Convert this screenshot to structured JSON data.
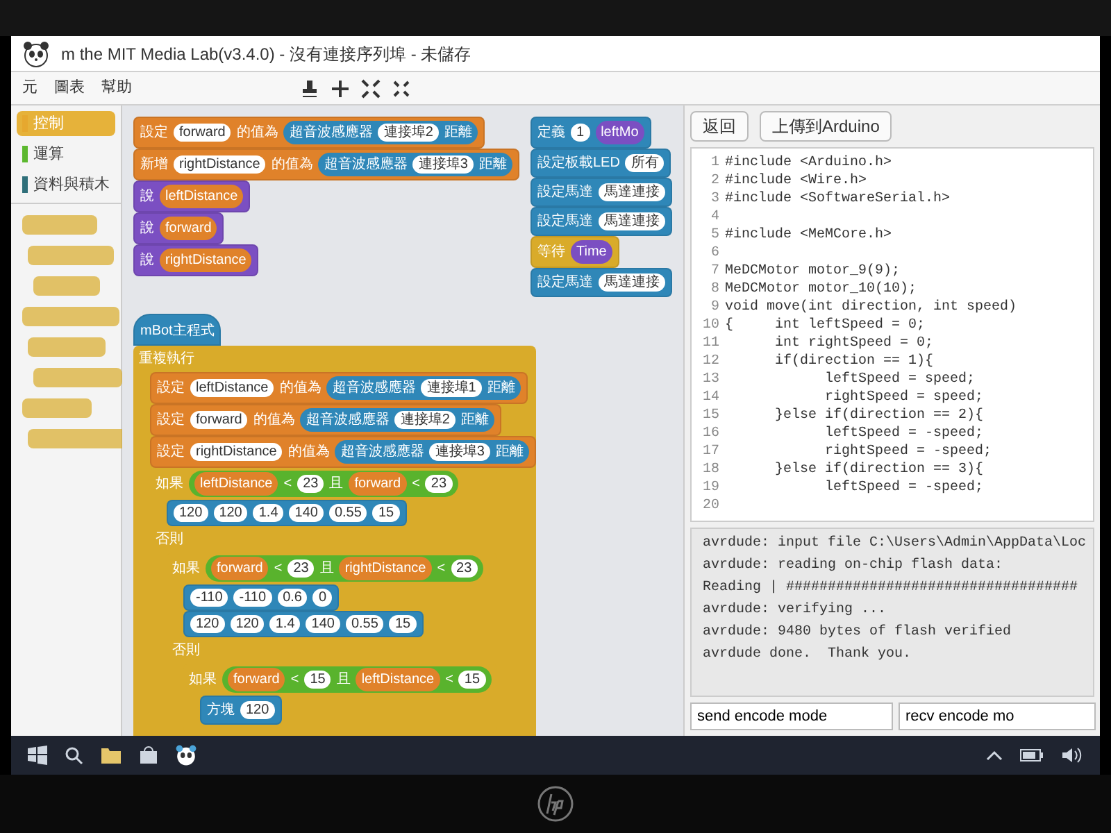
{
  "window": {
    "title": "m the MIT Media Lab(v3.4.0) - 沒有連接序列埠 - 未儲存"
  },
  "menu": [
    "元",
    "圖表",
    "幫助"
  ],
  "categories": [
    {
      "label": "控制",
      "selected": true,
      "color": "#e6a82f"
    },
    {
      "label": "運算",
      "selected": false,
      "color": "#5cb82f"
    },
    {
      "label": "資料與積木",
      "selected": false,
      "color": "#2f6f7a"
    }
  ],
  "scripts": [
    [
      {
        "kind": "stack",
        "color": "#e0822a",
        "parts": [
          {
            "kind": "text",
            "text": "設定"
          },
          {
            "kind": "field",
            "text": "forward"
          },
          {
            "kind": "text",
            "text": "的值為"
          },
          {
            "kind": "reporter",
            "color": "#2f87b8",
            "parts": [
              {
                "kind": "text",
                "text": "超音波感應器"
              },
              {
                "kind": "field",
                "text": "連接埠2"
              },
              {
                "kind": "text",
                "text": "距離"
              }
            ]
          }
        ]
      },
      {
        "kind": "stack",
        "color": "#e0822a",
        "parts": [
          {
            "kind": "text",
            "text": "新增"
          },
          {
            "kind": "field",
            "text": "rightDistance"
          },
          {
            "kind": "text",
            "text": "的值為"
          },
          {
            "kind": "reporter",
            "color": "#2f87b8",
            "parts": [
              {
                "kind": "text",
                "text": "超音波感應器"
              },
              {
                "kind": "field",
                "text": "連接埠3"
              },
              {
                "kind": "text",
                "text": "距離"
              }
            ]
          }
        ]
      },
      {
        "kind": "stack",
        "color": "#7b4fc2",
        "parts": [
          {
            "kind": "text",
            "text": "說"
          },
          {
            "kind": "reporter",
            "color": "#e0822a",
            "parts": [
              {
                "kind": "text",
                "text": "leftDistance"
              }
            ]
          }
        ]
      },
      {
        "kind": "stack",
        "color": "#7b4fc2",
        "parts": [
          {
            "kind": "text",
            "text": "說"
          },
          {
            "kind": "reporter",
            "color": "#e0822a",
            "parts": [
              {
                "kind": "text",
                "text": "forward"
              }
            ]
          }
        ]
      },
      {
        "kind": "stack",
        "color": "#7b4fc2",
        "parts": [
          {
            "kind": "text",
            "text": "說"
          },
          {
            "kind": "reporter",
            "color": "#e0822a",
            "parts": [
              {
                "kind": "text",
                "text": "rightDistance"
              }
            ]
          }
        ]
      }
    ],
    [
      {
        "kind": "stack",
        "color": "#2f87b8",
        "parts": [
          {
            "kind": "text",
            "text": "定義"
          },
          {
            "kind": "field",
            "text": "1"
          },
          {
            "kind": "reporter",
            "color": "#7b4fc2",
            "parts": [
              {
                "kind": "text",
                "text": "leftMo"
              }
            ]
          }
        ]
      },
      {
        "kind": "stack",
        "color": "#2f87b8",
        "parts": [
          {
            "kind": "text",
            "text": "設定板載LED"
          },
          {
            "kind": "field",
            "text": "所有"
          }
        ]
      },
      {
        "kind": "stack",
        "color": "#2f87b8",
        "parts": [
          {
            "kind": "text",
            "text": "設定馬達"
          },
          {
            "kind": "field",
            "text": "馬達連接"
          }
        ]
      },
      {
        "kind": "stack",
        "color": "#2f87b8",
        "parts": [
          {
            "kind": "text",
            "text": "設定馬達"
          },
          {
            "kind": "field",
            "text": "馬達連接"
          }
        ]
      },
      {
        "kind": "stack",
        "color": "#d9ab2a",
        "parts": [
          {
            "kind": "text",
            "text": "等待"
          },
          {
            "kind": "reporter",
            "color": "#7b4fc2",
            "parts": [
              {
                "kind": "text",
                "text": "Time"
              }
            ]
          }
        ]
      },
      {
        "kind": "stack",
        "color": "#2f87b8",
        "parts": [
          {
            "kind": "text",
            "text": "設定馬達"
          },
          {
            "kind": "field",
            "text": "馬達連接"
          }
        ]
      }
    ],
    [
      {
        "kind": "hat",
        "color": "#2f87b8",
        "parts": [
          {
            "kind": "text",
            "text": "mBot主程式"
          }
        ]
      },
      {
        "kind": "c",
        "color": "#d9ab2a",
        "parts": [
          {
            "kind": "text",
            "text": "重複執行"
          }
        ],
        "children": [
          {
            "kind": "stack",
            "color": "#e0822a",
            "parts": [
              {
                "kind": "text",
                "text": "設定"
              },
              {
                "kind": "field",
                "text": "leftDistance"
              },
              {
                "kind": "text",
                "text": "的值為"
              },
              {
                "kind": "reporter",
                "color": "#2f87b8",
                "parts": [
                  {
                    "kind": "text",
                    "text": "超音波感應器"
                  },
                  {
                    "kind": "field",
                    "text": "連接埠1"
                  },
                  {
                    "kind": "text",
                    "text": "距離"
                  }
                ]
              }
            ]
          },
          {
            "kind": "stack",
            "color": "#e0822a",
            "parts": [
              {
                "kind": "text",
                "text": "設定"
              },
              {
                "kind": "field",
                "text": "forward"
              },
              {
                "kind": "text",
                "text": "的值為"
              },
              {
                "kind": "reporter",
                "color": "#2f87b8",
                "parts": [
                  {
                    "kind": "text",
                    "text": "超音波感應器"
                  },
                  {
                    "kind": "field",
                    "text": "連接埠2"
                  },
                  {
                    "kind": "text",
                    "text": "距離"
                  }
                ]
              }
            ]
          },
          {
            "kind": "stack",
            "color": "#e0822a",
            "parts": [
              {
                "kind": "text",
                "text": "設定"
              },
              {
                "kind": "field",
                "text": "rightDistance"
              },
              {
                "kind": "text",
                "text": "的值為"
              },
              {
                "kind": "reporter",
                "color": "#2f87b8",
                "parts": [
                  {
                    "kind": "text",
                    "text": "超音波感應器"
                  },
                  {
                    "kind": "field",
                    "text": "連接埠3"
                  },
                  {
                    "kind": "text",
                    "text": "距離"
                  }
                ]
              }
            ]
          },
          {
            "kind": "c",
            "color": "#d9ab2a",
            "parts": [
              {
                "kind": "text",
                "text": "如果"
              },
              {
                "kind": "reporter",
                "color": "#59b32d",
                "parts": [
                  {
                    "kind": "reporter",
                    "color": "#e0822a",
                    "parts": [
                      {
                        "kind": "text",
                        "text": "leftDistance"
                      }
                    ]
                  },
                  {
                    "kind": "text",
                    "text": "<"
                  },
                  {
                    "kind": "field",
                    "text": "23"
                  },
                  {
                    "kind": "text",
                    "text": "且"
                  },
                  {
                    "kind": "reporter",
                    "color": "#e0822a",
                    "parts": [
                      {
                        "kind": "text",
                        "text": "forward"
                      }
                    ]
                  },
                  {
                    "kind": "text",
                    "text": "<"
                  },
                  {
                    "kind": "field",
                    "text": "23"
                  }
                ]
              }
            ],
            "children": [
              {
                "kind": "stack",
                "color": "#2f87b8",
                "parts": [
                  {
                    "kind": "field",
                    "text": "120"
                  },
                  {
                    "kind": "field",
                    "text": "120"
                  },
                  {
                    "kind": "field",
                    "text": "1.4"
                  },
                  {
                    "kind": "field",
                    "text": "140"
                  },
                  {
                    "kind": "field",
                    "text": "0.55"
                  },
                  {
                    "kind": "field",
                    "text": "15"
                  }
                ]
              }
            ],
            "else_label": "否則",
            "else_children": [
              {
                "kind": "c",
                "color": "#d9ab2a",
                "parts": [
                  {
                    "kind": "text",
                    "text": "如果"
                  },
                  {
                    "kind": "reporter",
                    "color": "#59b32d",
                    "parts": [
                      {
                        "kind": "reporter",
                        "color": "#e0822a",
                        "parts": [
                          {
                            "kind": "text",
                            "text": "forward"
                          }
                        ]
                      },
                      {
                        "kind": "text",
                        "text": "<"
                      },
                      {
                        "kind": "field",
                        "text": "23"
                      },
                      {
                        "kind": "text",
                        "text": "且"
                      },
                      {
                        "kind": "reporter",
                        "color": "#e0822a",
                        "parts": [
                          {
                            "kind": "text",
                            "text": "rightDistance"
                          }
                        ]
                      },
                      {
                        "kind": "text",
                        "text": "<"
                      },
                      {
                        "kind": "field",
                        "text": "23"
                      }
                    ]
                  }
                ],
                "children": [
                  {
                    "kind": "stack",
                    "color": "#2f87b8",
                    "parts": [
                      {
                        "kind": "field",
                        "text": "-110"
                      },
                      {
                        "kind": "field",
                        "text": "-110"
                      },
                      {
                        "kind": "field",
                        "text": "0.6"
                      },
                      {
                        "kind": "field",
                        "text": "0"
                      }
                    ]
                  },
                  {
                    "kind": "stack",
                    "color": "#2f87b8",
                    "parts": [
                      {
                        "kind": "field",
                        "text": "120"
                      },
                      {
                        "kind": "field",
                        "text": "120"
                      },
                      {
                        "kind": "field",
                        "text": "1.4"
                      },
                      {
                        "kind": "field",
                        "text": "140"
                      },
                      {
                        "kind": "field",
                        "text": "0.55"
                      },
                      {
                        "kind": "field",
                        "text": "15"
                      }
                    ]
                  }
                ],
                "else_label": "否則",
                "else_children": [
                  {
                    "kind": "c",
                    "color": "#d9ab2a",
                    "parts": [
                      {
                        "kind": "text",
                        "text": "如果"
                      },
                      {
                        "kind": "reporter",
                        "color": "#59b32d",
                        "parts": [
                          {
                            "kind": "reporter",
                            "color": "#e0822a",
                            "parts": [
                              {
                                "kind": "text",
                                "text": "forward"
                              }
                            ]
                          },
                          {
                            "kind": "text",
                            "text": "<"
                          },
                          {
                            "kind": "field",
                            "text": "15"
                          },
                          {
                            "kind": "text",
                            "text": "且"
                          },
                          {
                            "kind": "reporter",
                            "color": "#e0822a",
                            "parts": [
                              {
                                "kind": "text",
                                "text": "leftDistance"
                              }
                            ]
                          },
                          {
                            "kind": "text",
                            "text": "<"
                          },
                          {
                            "kind": "field",
                            "text": "15"
                          }
                        ]
                      }
                    ],
                    "children": [
                      {
                        "kind": "stack",
                        "color": "#2f87b8",
                        "parts": [
                          {
                            "kind": "text",
                            "text": "方塊"
                          },
                          {
                            "kind": "field",
                            "text": "120"
                          }
                        ]
                      }
                    ]
                  }
                ]
              }
            ]
          }
        ]
      }
    ]
  ],
  "buttons": [
    "返回",
    "上傳到Arduino"
  ],
  "code": [
    {
      "num": "1",
      "text": "#include <Arduino.h>"
    },
    {
      "num": "2",
      "text": "#include <Wire.h>"
    },
    {
      "num": "3",
      "text": "#include <SoftwareSerial.h>"
    },
    {
      "num": "4"
    },
    {
      "num": "5",
      "text": "#include <MeMCore.h>"
    },
    {
      "num": "6"
    },
    {
      "num": "7",
      "text": "MeDCMotor motor_9(9);"
    },
    {
      "num": "8",
      "text": "MeDCMotor motor_10(10);"
    },
    {
      "num": "9",
      "text": "void move(int direction, int speed)"
    },
    {
      "num": "10",
      "text": "{     int leftSpeed = 0;"
    },
    {
      "num": "11",
      "text": "      int rightSpeed = 0;"
    },
    {
      "num": "12",
      "text": "      if(direction == 1){"
    },
    {
      "num": "13",
      "text": "            leftSpeed = speed;"
    },
    {
      "num": "14",
      "text": "            rightSpeed = speed;"
    },
    {
      "num": "15",
      "text": "      }else if(direction == 2){"
    },
    {
      "num": "16",
      "text": "            leftSpeed = -speed;"
    },
    {
      "num": "17",
      "text": "            rightSpeed = -speed;"
    },
    {
      "num": "18",
      "text": "      }else if(direction == 3){"
    },
    {
      "num": "19",
      "text": "            leftSpeed = -speed;"
    },
    {
      "num": "20"
    }
  ],
  "console": [
    "avrdude: input file C:\\Users\\Admin\\AppData\\Loc",
    "avrdude: reading on-chip flash data:",
    "Reading | ###################################",
    "avrdude: verifying ...",
    "avrdude: 9480 bytes of flash verified",
    "avrdude done.  Thank you."
  ],
  "send_field": {
    "value": "send encode mode"
  },
  "recv_field": {
    "value": "recv encode mo"
  }
}
